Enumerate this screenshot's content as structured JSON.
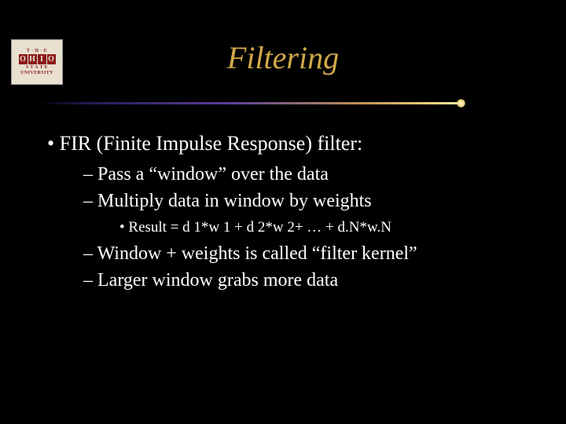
{
  "logo": {
    "top": "T · H · E",
    "letters": [
      "O",
      "H",
      "I",
      "O"
    ],
    "mid": "S T A T E",
    "bottom": "UNIVERSITY"
  },
  "title": "Filtering",
  "content": {
    "heading": "FIR (Finite Impulse Response) filter:",
    "sub": [
      "Pass a “window” over the data",
      "Multiply data in window by weights"
    ],
    "formula": "Result = d 1*w 1 + d 2*w 2+ … + d.N*w.N",
    "sub2": [
      "Window + weights is called “filter kernel”",
      "Larger window grabs more data"
    ]
  }
}
